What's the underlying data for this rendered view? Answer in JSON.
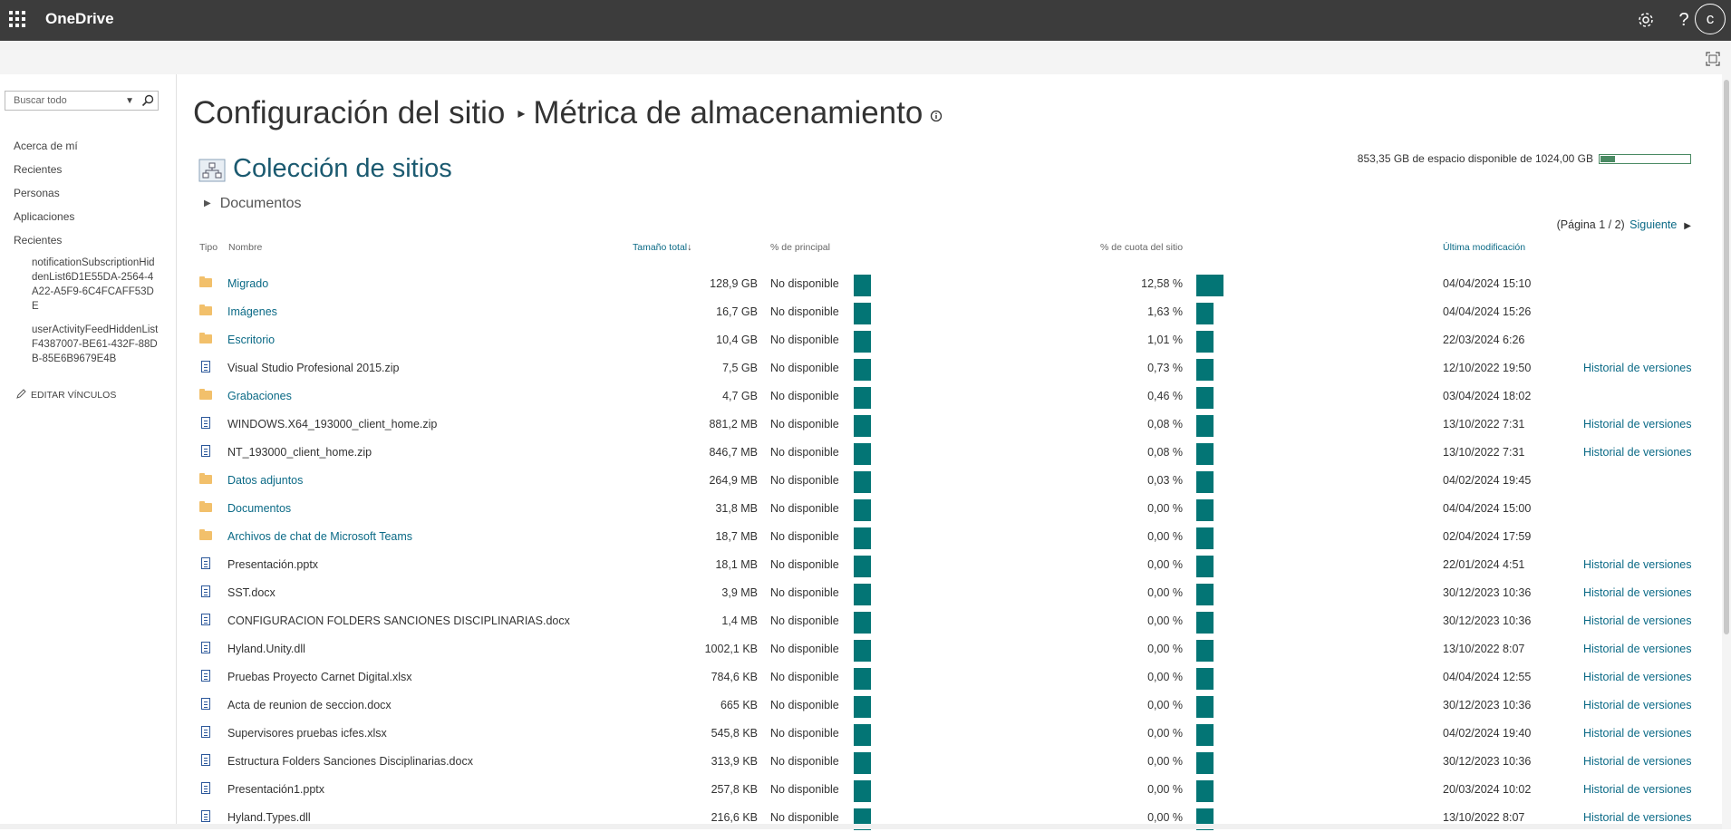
{
  "app": {
    "brand": "OneDrive",
    "avatar_letter": "c"
  },
  "search": {
    "placeholder": "Buscar todo"
  },
  "nav": {
    "items": [
      "Acerca de mí",
      "Recientes",
      "Personas",
      "Aplicaciones",
      "Recientes"
    ],
    "sub_items": [
      "notificationSubscriptionHiddenList6D1E55DA-2564-4A22-A5F9-6C4FCAFF53DE",
      "userActivityFeedHiddenListF4387007-BE61-432F-88DB-85E6B9679E4B"
    ],
    "edit_links": "EDITAR VÍNCULOS"
  },
  "breadcrumb": {
    "parent": "Configuración del sitio",
    "current": "Métrica de almacenamiento"
  },
  "collection": {
    "title": "Colección de sitios",
    "folder": "Documentos"
  },
  "storage": {
    "text": "853,35 GB de espacio disponible de 1024,00 GB",
    "used_fraction": 0.167
  },
  "pager": {
    "text": "(Página 1 / 2)",
    "next": "Siguiente"
  },
  "columns": {
    "type": "Tipo",
    "name": "Nombre",
    "size": "Tamaño total",
    "pct_parent": "% de principal",
    "pct_quota": "% de cuota del sitio",
    "modified": "Última modificación"
  },
  "rows": [
    {
      "type": "folder",
      "name": "Migrado",
      "size": "128,9 GB",
      "parent": "No disponible",
      "quota": "12,58 %",
      "quota_value": 12.58,
      "modified": "04/04/2024 15:10",
      "history": ""
    },
    {
      "type": "folder",
      "name": "Imágenes",
      "size": "16,7 GB",
      "parent": "No disponible",
      "quota": "1,63 %",
      "quota_value": 1.63,
      "modified": "04/04/2024 15:26",
      "history": ""
    },
    {
      "type": "folder",
      "name": "Escritorio",
      "size": "10,4 GB",
      "parent": "No disponible",
      "quota": "1,01 %",
      "quota_value": 1.01,
      "modified": "22/03/2024 6:26",
      "history": ""
    },
    {
      "type": "file",
      "name": "Visual Studio Profesional 2015.zip",
      "size": "7,5 GB",
      "parent": "No disponible",
      "quota": "0,73 %",
      "quota_value": 0.73,
      "modified": "12/10/2022 19:50",
      "history": "Historial de versiones"
    },
    {
      "type": "folder",
      "name": "Grabaciones",
      "size": "4,7 GB",
      "parent": "No disponible",
      "quota": "0,46 %",
      "quota_value": 0.46,
      "modified": "03/04/2024 18:02",
      "history": ""
    },
    {
      "type": "file",
      "name": "WINDOWS.X64_193000_client_home.zip",
      "size": "881,2 MB",
      "parent": "No disponible",
      "quota": "0,08 %",
      "quota_value": 0.08,
      "modified": "13/10/2022 7:31",
      "history": "Historial de versiones"
    },
    {
      "type": "file",
      "name": "NT_193000_client_home.zip",
      "size": "846,7 MB",
      "parent": "No disponible",
      "quota": "0,08 %",
      "quota_value": 0.08,
      "modified": "13/10/2022 7:31",
      "history": "Historial de versiones"
    },
    {
      "type": "folder",
      "name": "Datos adjuntos",
      "size": "264,9 MB",
      "parent": "No disponible",
      "quota": "0,03 %",
      "quota_value": 0.03,
      "modified": "04/02/2024 19:45",
      "history": ""
    },
    {
      "type": "folder",
      "name": "Documentos",
      "size": "31,8 MB",
      "parent": "No disponible",
      "quota": "0,00 %",
      "quota_value": 0,
      "modified": "04/04/2024 15:00",
      "history": ""
    },
    {
      "type": "folder",
      "name": "Archivos de chat de Microsoft Teams",
      "size": "18,7 MB",
      "parent": "No disponible",
      "quota": "0,00 %",
      "quota_value": 0,
      "modified": "02/04/2024 17:59",
      "history": ""
    },
    {
      "type": "file",
      "name": "Presentación.pptx",
      "size": "18,1 MB",
      "parent": "No disponible",
      "quota": "0,00 %",
      "quota_value": 0,
      "modified": "22/01/2024 4:51",
      "history": "Historial de versiones"
    },
    {
      "type": "file",
      "name": "SST.docx",
      "size": "3,9 MB",
      "parent": "No disponible",
      "quota": "0,00 %",
      "quota_value": 0,
      "modified": "30/12/2023 10:36",
      "history": "Historial de versiones"
    },
    {
      "type": "file",
      "name": "CONFIGURACION FOLDERS SANCIONES DISCIPLINARIAS.docx",
      "size": "1,4 MB",
      "parent": "No disponible",
      "quota": "0,00 %",
      "quota_value": 0,
      "modified": "30/12/2023 10:36",
      "history": "Historial de versiones"
    },
    {
      "type": "file",
      "name": "Hyland.Unity.dll",
      "size": "1002,1 KB",
      "parent": "No disponible",
      "quota": "0,00 %",
      "quota_value": 0,
      "modified": "13/10/2022 8:07",
      "history": "Historial de versiones"
    },
    {
      "type": "file",
      "name": "Pruebas Proyecto Carnet Digital.xlsx",
      "size": "784,6 KB",
      "parent": "No disponible",
      "quota": "0,00 %",
      "quota_value": 0,
      "modified": "04/04/2024 12:55",
      "history": "Historial de versiones"
    },
    {
      "type": "file",
      "name": "Acta de reunion de seccion.docx",
      "size": "665 KB",
      "parent": "No disponible",
      "quota": "0,00 %",
      "quota_value": 0,
      "modified": "30/12/2023 10:36",
      "history": "Historial de versiones"
    },
    {
      "type": "file",
      "name": "Supervisores pruebas icfes.xlsx",
      "size": "545,8 KB",
      "parent": "No disponible",
      "quota": "0,00 %",
      "quota_value": 0,
      "modified": "04/02/2024 19:40",
      "history": "Historial de versiones"
    },
    {
      "type": "file",
      "name": "Estructura Folders Sanciones Disciplinarias.docx",
      "size": "313,9 KB",
      "parent": "No disponible",
      "quota": "0,00 %",
      "quota_value": 0,
      "modified": "30/12/2023 10:36",
      "history": "Historial de versiones"
    },
    {
      "type": "file",
      "name": "Presentación1.pptx",
      "size": "257,8 KB",
      "parent": "No disponible",
      "quota": "0,00 %",
      "quota_value": 0,
      "modified": "20/03/2024 10:02",
      "history": "Historial de versiones"
    },
    {
      "type": "file",
      "name": "Hyland.Types.dll",
      "size": "216,6 KB",
      "parent": "No disponible",
      "quota": "0,00 %",
      "quota_value": 0,
      "modified": "13/10/2022 8:07",
      "history": "Historial de versiones"
    }
  ]
}
